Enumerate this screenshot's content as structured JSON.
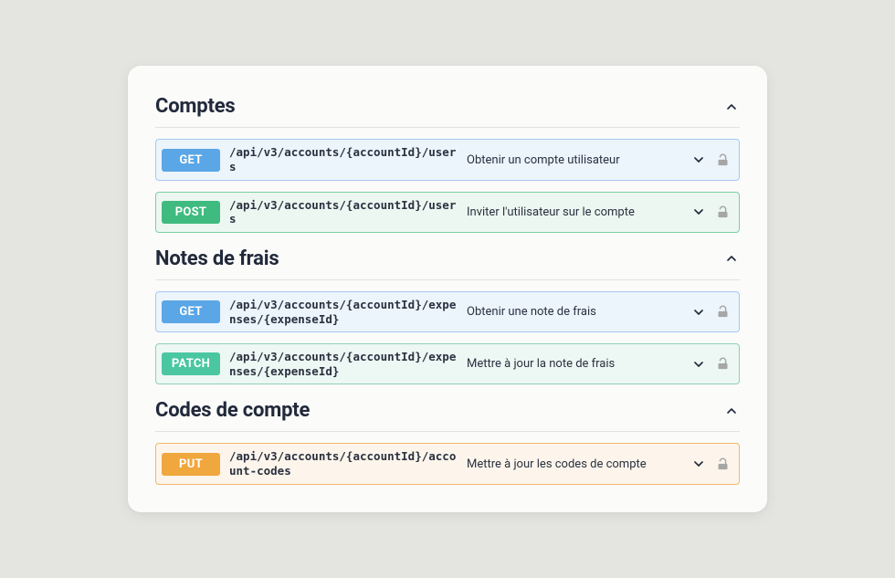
{
  "sections": [
    {
      "title": "Comptes",
      "endpoints": [
        {
          "method": "GET",
          "method_class": "get",
          "path": "/api/v3/accounts/{accountId}/users",
          "desc": "Obtenir un compte utilisateur"
        },
        {
          "method": "POST",
          "method_class": "post",
          "path": "/api/v3/accounts/{accountId}/users",
          "desc": "Inviter l'utilisateur sur le compte"
        }
      ]
    },
    {
      "title": "Notes de frais",
      "endpoints": [
        {
          "method": "GET",
          "method_class": "get",
          "path": "/api/v3/accounts/{accountId}/expenses/{expenseId}",
          "desc": "Obtenir une note de frais"
        },
        {
          "method": "PATCH",
          "method_class": "patch",
          "path": "/api/v3/accounts/{accountId}/expenses/{expenseId}",
          "desc": "Mettre à jour la note de frais"
        }
      ]
    },
    {
      "title": "Codes de compte",
      "endpoints": [
        {
          "method": "PUT",
          "method_class": "put",
          "path": "/api/v3/accounts/{accountId}/account-codes",
          "desc": "Mettre à jour les codes de compte"
        }
      ]
    }
  ]
}
